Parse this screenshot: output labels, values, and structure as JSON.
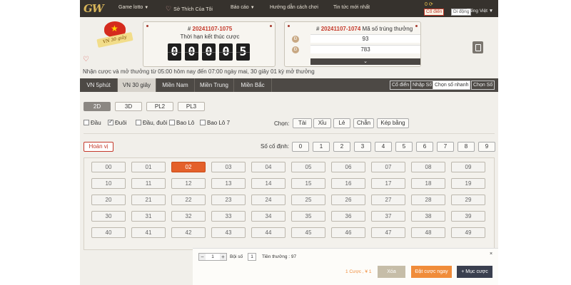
{
  "nav": {
    "logo": "GW",
    "items": [
      "Game lotto",
      "Sở Thích Của Tôi",
      "Báo cáo",
      "Hướng dẫn cách chơi",
      "Tin tức mới nhất"
    ],
    "user_line": "0 ⟳",
    "btn_codien": "Cổ điển",
    "btn_didong": "Di động",
    "lang": "Tiếng Việt"
  },
  "header": {
    "badge_text": "VN 30 giây",
    "draw_label_hash": "#",
    "draw_id": "20241107-1075",
    "draw_caption": "Thời hạn kết thúc cược",
    "countdown": [
      "0",
      "0",
      "0",
      "0",
      "5"
    ],
    "result_hash": "#",
    "result_id": "20241107-1074",
    "result_caption": "Mã số trúng thưởng",
    "result_rows": [
      {
        "ball": "Đ",
        "value": "93"
      },
      {
        "ball": "Đ",
        "value": "783"
      }
    ],
    "expand_icon": "chevron-down",
    "notice": "Nhận cược và mở thưởng từ 05:00 hôm nay đến 07:00 ngày mai,   30 giây 01 kỳ mở thưởng"
  },
  "tabs": [
    "VN 5phút",
    "VN 30 giây",
    "Miền Nam",
    "Miền Trung",
    "Miền Bắc"
  ],
  "active_tab": "VN 30 giây",
  "modes": [
    "Cổ điển",
    "Nhập Số",
    "Chọn số nhanh",
    "Chọn Số"
  ],
  "active_mode": "Chọn số nhanh",
  "subtabs": [
    "2D",
    "3D",
    "PL2",
    "PL3"
  ],
  "active_subtab": "2D",
  "checks": [
    {
      "label": "Đầu",
      "checked": false
    },
    {
      "label": "Đuôi",
      "checked": true
    },
    {
      "label": "Đầu, đuôi",
      "checked": false
    },
    {
      "label": "Bao Lô",
      "checked": false
    },
    {
      "label": "Bao Lô 7",
      "checked": false
    }
  ],
  "chon": {
    "label": "Chọn:",
    "buttons": [
      "Tài",
      "Xỉu",
      "Lẻ",
      "Chẵn",
      "Kép bằng"
    ]
  },
  "hoanvi": "Hoán vị",
  "codinh": {
    "label": "Số cố định:",
    "digits": [
      "0",
      "1",
      "2",
      "3",
      "4",
      "5",
      "6",
      "7",
      "8",
      "9"
    ]
  },
  "numbers": [
    "00",
    "01",
    "02",
    "03",
    "04",
    "05",
    "06",
    "07",
    "08",
    "09",
    "10",
    "11",
    "12",
    "13",
    "14",
    "15",
    "16",
    "17",
    "18",
    "19",
    "20",
    "21",
    "22",
    "23",
    "24",
    "25",
    "26",
    "27",
    "28",
    "29",
    "30",
    "31",
    "32",
    "33",
    "34",
    "35",
    "36",
    "37",
    "38",
    "39",
    "40",
    "41",
    "42",
    "43",
    "44",
    "45",
    "46",
    "47",
    "48",
    "49"
  ],
  "selected_number": "02",
  "bottom": {
    "stepper_minus": "−",
    "stepper_value": "1",
    "stepper_plus": "+",
    "boiso_label": "Bội số",
    "boiso_value": "1",
    "tien_thuong": "Tiền thưởng : 97",
    "close": "×",
    "summary": "1 Cược , ¥ 1",
    "btn_xoa": "Xóa",
    "btn_dat": "Đặt cược ngay",
    "btn_muc": "+ Mục cược"
  },
  "colors": {
    "nav_bg": "#36322d",
    "accent_orange": "#e4602a",
    "brand_red": "#c5392a",
    "app_bg": "#f1efea"
  }
}
